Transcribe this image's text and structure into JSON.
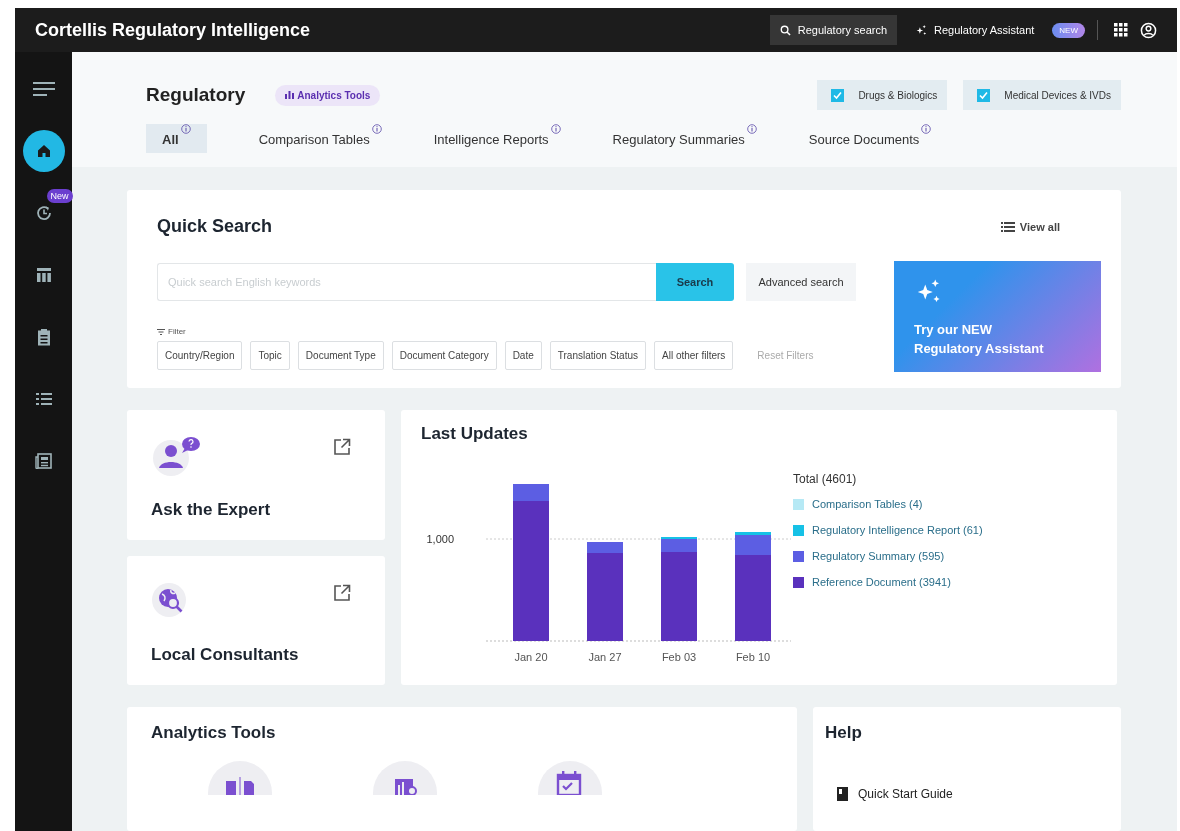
{
  "app": {
    "title": "Cortellis Regulatory Intelligence"
  },
  "topbar": {
    "search_label": "Regulatory search",
    "assistant_label": "Regulatory Assistant",
    "assistant_badge": "NEW"
  },
  "sidebar": {
    "items": [
      {
        "kind": "menu",
        "selected": false
      },
      {
        "kind": "home",
        "selected": true
      },
      {
        "kind": "history",
        "selected": false,
        "badge": "New"
      },
      {
        "kind": "table",
        "selected": false
      },
      {
        "kind": "clipboard",
        "selected": false
      },
      {
        "kind": "list",
        "selected": false
      },
      {
        "kind": "news",
        "selected": false
      }
    ]
  },
  "header": {
    "title": "Regulatory",
    "badge": "Analytics Tools",
    "checkboxes": [
      {
        "label": "Drugs & Biologics",
        "checked": true
      },
      {
        "label": "Medical Devices & IVDs",
        "checked": true
      }
    ],
    "tabs": [
      {
        "label": "All",
        "selected": true
      },
      {
        "label": "Comparison Tables",
        "selected": false
      },
      {
        "label": "Intelligence Reports",
        "selected": false
      },
      {
        "label": "Regulatory Summaries",
        "selected": false
      },
      {
        "label": "Source Documents",
        "selected": false
      }
    ]
  },
  "quick_search": {
    "title": "Quick Search",
    "view_all": "View all",
    "placeholder": "Quick search English keywords",
    "search_button": "Search",
    "advanced_button": "Advanced search",
    "filter_label": "Filter",
    "filters": [
      "Country/Region",
      "Topic",
      "Document Type",
      "Document Category",
      "Date",
      "Translation Status",
      "All other filters"
    ],
    "reset": "Reset Filters",
    "promo_lines": [
      "Try our NEW",
      "Regulatory Assistant"
    ]
  },
  "services": [
    {
      "kind": "expert",
      "title": "Ask the Expert"
    },
    {
      "kind": "consultants",
      "title": "Local Consultants"
    }
  ],
  "last_updates": {
    "title": "Last Updates",
    "total": "Total (4601)",
    "axis_label": "1,000",
    "categories": [
      "Jan 20",
      "Jan 27",
      "Feb 03",
      "Feb 10"
    ],
    "legend": [
      {
        "label": "Comparison Tables (4)",
        "color": "#b6e9f5"
      },
      {
        "label": "Regulatory Intelligence Report (61)",
        "color": "#16c1e6"
      },
      {
        "label": "Regulatory Summary (595)",
        "color": "#5c5ee3"
      },
      {
        "label": "Reference Document (3941)",
        "color": "#5a31bd"
      }
    ]
  },
  "analytics_tools": {
    "title": "Analytics Tools",
    "tools": [
      {
        "kind": "compare"
      },
      {
        "kind": "chart"
      },
      {
        "kind": "calendar"
      }
    ]
  },
  "help": {
    "title": "Help",
    "links": [
      {
        "label": "Quick Start Guide"
      }
    ]
  }
}
